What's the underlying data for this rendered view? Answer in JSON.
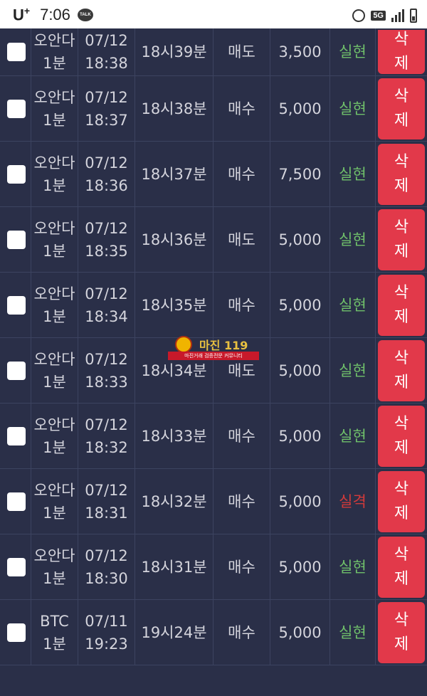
{
  "status_bar": {
    "carrier": "U",
    "carrier_sup": "+",
    "time": "7:06",
    "talk_badge": "TALK",
    "network": "5G"
  },
  "rows": [
    {
      "coin": "오안다",
      "interval": "1분",
      "date": "07/12",
      "time": "18:38",
      "round": "18시39분",
      "type": "매도",
      "amount": "3,500",
      "result": "실현",
      "result_kind": "win",
      "del1": "삭",
      "del2": "제"
    },
    {
      "coin": "오안다",
      "interval": "1분",
      "date": "07/12",
      "time": "18:37",
      "round": "18시38분",
      "type": "매수",
      "amount": "5,000",
      "result": "실현",
      "result_kind": "win",
      "del1": "삭",
      "del2": "제"
    },
    {
      "coin": "오안다",
      "interval": "1분",
      "date": "07/12",
      "time": "18:36",
      "round": "18시37분",
      "type": "매수",
      "amount": "7,500",
      "result": "실현",
      "result_kind": "win",
      "del1": "삭",
      "del2": "제"
    },
    {
      "coin": "오안다",
      "interval": "1분",
      "date": "07/12",
      "time": "18:35",
      "round": "18시36분",
      "type": "매도",
      "amount": "5,000",
      "result": "실현",
      "result_kind": "win",
      "del1": "삭",
      "del2": "제"
    },
    {
      "coin": "오안다",
      "interval": "1분",
      "date": "07/12",
      "time": "18:34",
      "round": "18시35분",
      "type": "매수",
      "amount": "5,000",
      "result": "실현",
      "result_kind": "win",
      "del1": "삭",
      "del2": "제"
    },
    {
      "coin": "오안다",
      "interval": "1분",
      "date": "07/12",
      "time": "18:33",
      "round": "18시34분",
      "type": "매도",
      "amount": "5,000",
      "result": "실현",
      "result_kind": "win",
      "del1": "삭",
      "del2": "제"
    },
    {
      "coin": "오안다",
      "interval": "1분",
      "date": "07/12",
      "time": "18:32",
      "round": "18시33분",
      "type": "매수",
      "amount": "5,000",
      "result": "실현",
      "result_kind": "win",
      "del1": "삭",
      "del2": "제"
    },
    {
      "coin": "오안다",
      "interval": "1분",
      "date": "07/12",
      "time": "18:31",
      "round": "18시32분",
      "type": "매수",
      "amount": "5,000",
      "result": "실격",
      "result_kind": "lose",
      "del1": "삭",
      "del2": "제"
    },
    {
      "coin": "오안다",
      "interval": "1분",
      "date": "07/12",
      "time": "18:30",
      "round": "18시31분",
      "type": "매수",
      "amount": "5,000",
      "result": "실현",
      "result_kind": "win",
      "del1": "삭",
      "del2": "제"
    },
    {
      "coin": "BTC",
      "interval": "1분",
      "date": "07/11",
      "time": "19:23",
      "round": "19시24분",
      "type": "매수",
      "amount": "5,000",
      "result": "실현",
      "result_kind": "win",
      "del1": "삭",
      "del2": "제"
    }
  ],
  "watermark": {
    "brand": "마진 119",
    "tagline": "마진거래 검증전문 커뮤니티"
  },
  "colors": {
    "background": "#2a2f48",
    "delete_button": "#e2394a",
    "result_win": "#6fbf6a",
    "result_lose": "#d23a3a"
  }
}
